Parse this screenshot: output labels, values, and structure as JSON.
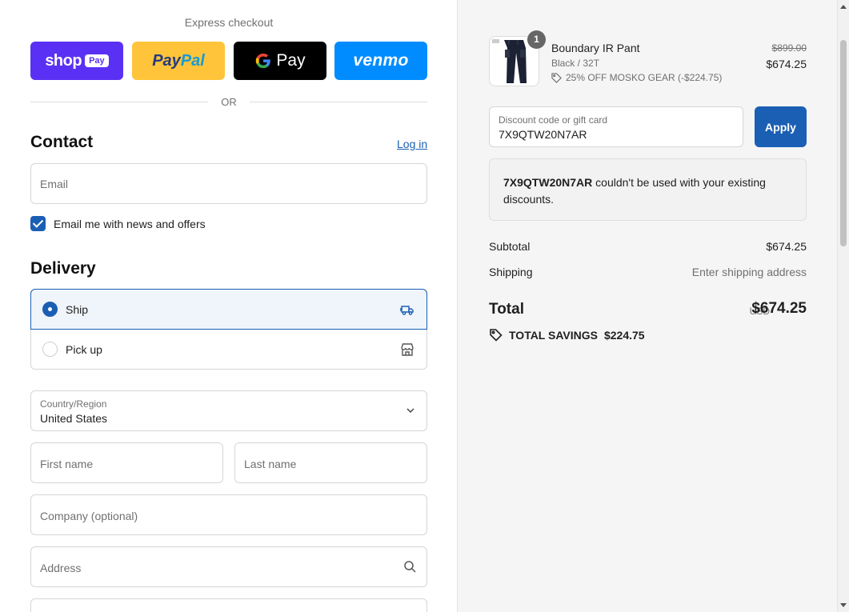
{
  "express": {
    "title": "Express checkout",
    "shop_pay": {
      "word": "shop",
      "badge": "Pay"
    },
    "paypal": {
      "part1": "Pay",
      "part2": "Pal"
    },
    "gpay": {
      "g": "G",
      "label": "Pay"
    },
    "venmo": {
      "label": "venmo"
    },
    "or": "OR"
  },
  "contact": {
    "title": "Contact",
    "login": "Log in",
    "email_placeholder": "Email",
    "newsletter_label": "Email me with news and offers",
    "newsletter_checked": true
  },
  "delivery": {
    "title": "Delivery",
    "options": [
      {
        "label": "Ship",
        "selected": true
      },
      {
        "label": "Pick up",
        "selected": false
      }
    ],
    "country_label": "Country/Region",
    "country_value": "United States",
    "first_name_placeholder": "First name",
    "last_name_placeholder": "Last name",
    "company_placeholder": "Company (optional)",
    "address_placeholder": "Address"
  },
  "order": {
    "item": {
      "name": "Boundary IR Pant",
      "variant": "Black / 32T",
      "discount": "25% OFF MOSKO GEAR (-$224.75)",
      "price_original": "$899.00",
      "price": "$674.25",
      "quantity": "1"
    },
    "discount_field": {
      "label": "Discount code or gift card",
      "value": "7X9QTW20N7AR"
    },
    "apply": "Apply",
    "error": {
      "code": "7X9QTW20N7AR",
      "message": " couldn't be used with your existing discounts."
    },
    "subtotal_label": "Subtotal",
    "subtotal_value": "$674.25",
    "shipping_label": "Shipping",
    "shipping_value": "Enter shipping address",
    "total_label": "Total",
    "total_currency": "USD",
    "total_value": "$674.25",
    "savings_label": "TOTAL SAVINGS",
    "savings_value": "$224.75"
  },
  "colors": {
    "accent": "#1a5fb4",
    "shop_pay": "#5a31f4",
    "paypal": "#ffc439",
    "venmo": "#008cff"
  }
}
